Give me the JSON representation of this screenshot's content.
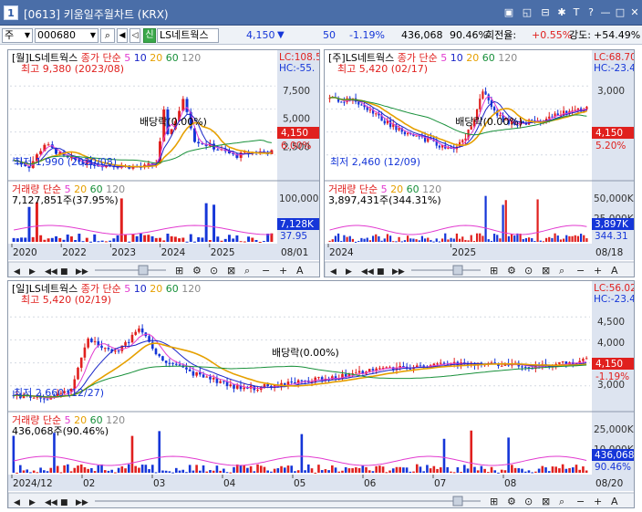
{
  "window": {
    "badge": "1",
    "title": "[0613] 키움일주월차트 (KRX)",
    "buttons": [
      "▣",
      "◱",
      "⊟",
      "✱",
      "T",
      "?",
      "—",
      "□",
      "✕"
    ]
  },
  "toolbar": {
    "market_select": "주",
    "code": "000680",
    "sector_badge": "신",
    "stock_name": "LS네트웍스",
    "price": "4,150",
    "price_arrow": "▼",
    "change": "50",
    "change_pct": "-1.19%",
    "volume": "436,068",
    "volume_pct": "90.46%",
    "turnover_label": "회전율:",
    "turnover": "+0.55%",
    "strength_label": "강도:",
    "strength": "+54.49%"
  },
  "colors": {
    "up": "#e0201e",
    "down": "#1536d8",
    "ma5": "#e23ad0",
    "ma10": "#1a26c8",
    "ma20": "#e6a000",
    "ma60": "#18903a",
    "ma120": "#8a8a8a",
    "axis_bg": "#dde4f0",
    "grid": "#d4d9e2"
  },
  "monthly": {
    "header": "[월]LS네트웍스",
    "ma_label": "종가 단순",
    "ma_periods": [
      "5",
      "10",
      "20",
      "60",
      "120"
    ],
    "high_note": "최고 9,380 (2023/08)",
    "low_note": "최저 1,990 (2020/08)",
    "dividend": "배당락(0.00%)",
    "hc": "HC:-55.",
    "lc": "LC:108.5",
    "price_tag": "4,150",
    "pct_tag": "6.00%",
    "yticks": [
      "7,500",
      "5,000",
      "2,500"
    ],
    "volume_label": "거래량",
    "volume_ma": "단순",
    "volume_ma_periods": [
      "5",
      "20",
      "60",
      "120"
    ],
    "volume_text": "7,127,851주(37.95%)",
    "volume_ticks": [
      "100,000"
    ],
    "volume_tag": "7,128K",
    "volume_pct_tag": "37.95",
    "xlabels": [
      "2020",
      "2022",
      "2023",
      "2024",
      "2025"
    ],
    "date_tag": "08/01"
  },
  "weekly": {
    "header": "[주]LS네트웍스",
    "ma_label": "종가 단순",
    "ma_periods": [
      "5",
      "10",
      "20",
      "60",
      "120"
    ],
    "high_note": "최고 5,420 (02/17)",
    "low_note": "최저 2,460 (12/09)",
    "dividend": "배당락(0.00%)",
    "hc": "HC:-23.4",
    "lc": "LC:68.70",
    "price_tag": "4,150",
    "pct_tag": "5.20%",
    "yticks": [
      "3,000"
    ],
    "volume_label": "거래량",
    "volume_ma": "단순",
    "volume_ma_periods": [
      "5",
      "20",
      "60",
      "120"
    ],
    "volume_text": "3,897,431주(344.31%)",
    "volume_ticks": [
      "50,000K",
      "25,000K"
    ],
    "volume_tag": "3,897K",
    "volume_pct_tag": "344.31",
    "xlabels": [
      "2024",
      "2025"
    ],
    "date_tag": "08/18"
  },
  "daily": {
    "header": "[일]LS네트웍스",
    "ma_label": "종가 단순",
    "ma_periods": [
      "5",
      "10",
      "20",
      "60",
      "120"
    ],
    "high_note": "최고 5,420 (02/19)",
    "low_note": "최저 2,660 (12/27)",
    "dividend": "배당락(0.00%)",
    "hc": "HC:-23.43",
    "lc": "LC:56.02",
    "price_tag": "4,150",
    "pct_tag": "-1.19%",
    "yticks": [
      "4,500",
      "4,000",
      "3,500",
      "3,000"
    ],
    "volume_label": "거래량",
    "volume_ma": "단순",
    "volume_ma_periods": [
      "5",
      "20",
      "60",
      "120"
    ],
    "volume_text": "436,068주(90.46%)",
    "volume_ticks": [
      "25,000K",
      "10,000K"
    ],
    "volume_tag": "436,068",
    "volume_pct_tag": "90.46%",
    "xlabels": [
      "2024/12",
      "02",
      "03",
      "04",
      "05",
      "06",
      "07",
      "08"
    ],
    "date_tag": "08/20"
  }
}
